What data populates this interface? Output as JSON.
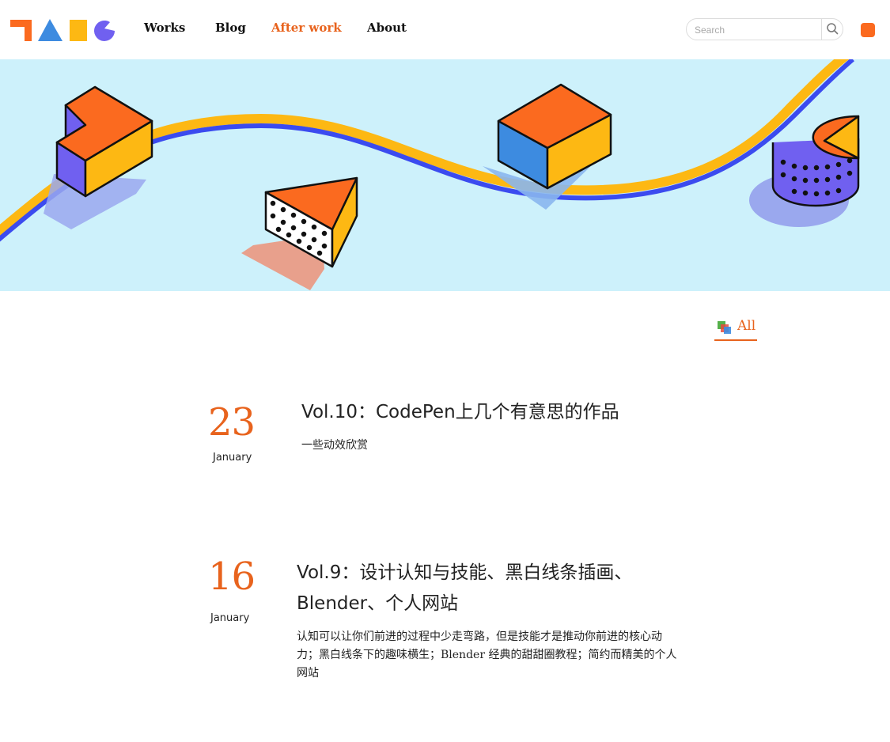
{
  "nav": {
    "items": [
      {
        "label": "Works",
        "active": false
      },
      {
        "label": "Blog",
        "active": false
      },
      {
        "label": "After work",
        "active": true
      },
      {
        "label": "About",
        "active": false
      }
    ]
  },
  "search": {
    "placeholder": "Search",
    "value": ""
  },
  "filter": {
    "label": "All"
  },
  "posts": [
    {
      "day": "23",
      "month": "January",
      "title": "Vol.10：CodePen上几个有意思的作品",
      "summary": "一些动效欣赏"
    },
    {
      "day": "16",
      "month": "January",
      "title": "Vol.9：设计认知与技能、黑白线条插画、Blender、个人网站",
      "summary": "认知可以让你们前进的过程中少走弯路，但是技能才是推动你前进的核心动力；黑白线条下的趣味横生；Blender 经典的甜甜圈教程；简约而精美的个人网站"
    }
  ],
  "icons": {
    "logo": "tang-logo-shapes",
    "search": "search-icon",
    "menu": "orange-square-icon",
    "filter": "stacked-squares-icon"
  },
  "colors": {
    "accent": "#e8631d",
    "hero_bg": "#cdf1fb",
    "orange": "#fb6a1f",
    "blue": "#3d8be0",
    "yellow": "#fdb813",
    "purple": "#7060f0"
  }
}
